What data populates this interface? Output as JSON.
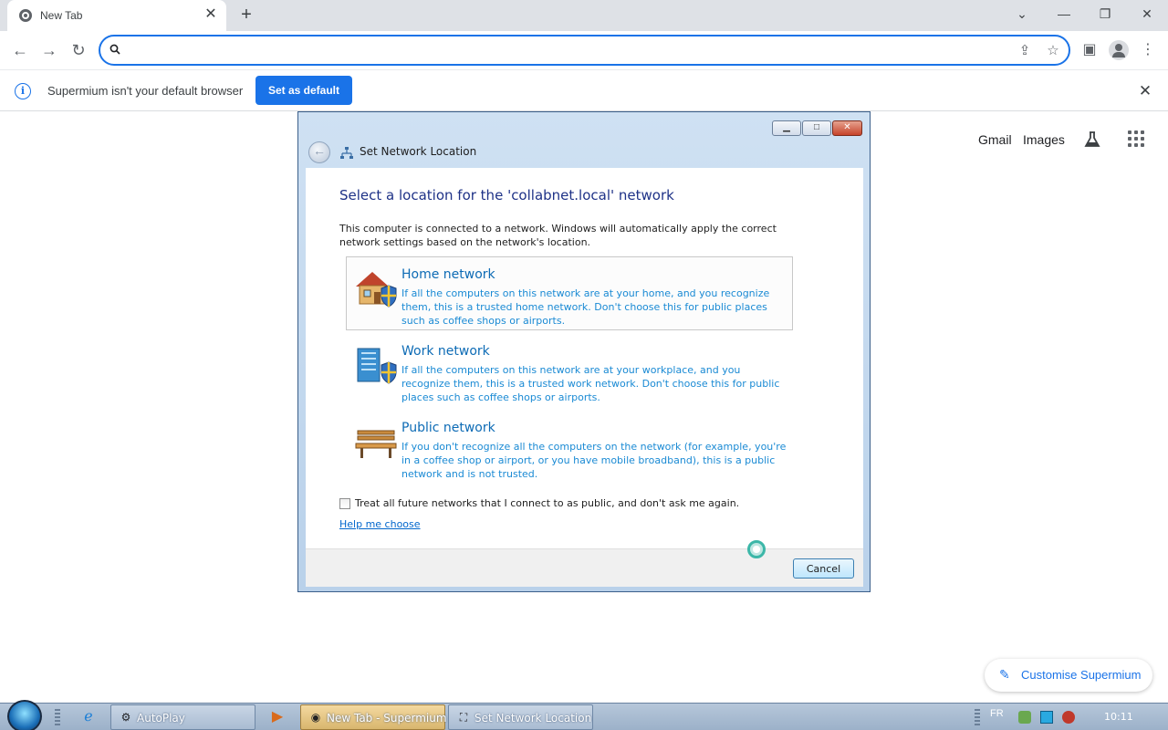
{
  "browser": {
    "tab": {
      "title": "New Tab",
      "close": "✕"
    },
    "new_tab": "+",
    "window_controls": {
      "minimize": "⌄",
      "min": "—",
      "restore": "❐",
      "close": "✕"
    },
    "omnibox": {
      "value": "",
      "placeholder": ""
    },
    "infobar": {
      "message": "Supermium isn't your default browser",
      "button": "Set as default",
      "close": "✕"
    },
    "ntp": {
      "links": [
        "Gmail",
        "Images"
      ],
      "customise_label": "Customise Supermium"
    }
  },
  "dialog": {
    "title": "Set Network Location",
    "heading": "Select a location for the 'collabnet.local' network",
    "description": "This computer is connected to a network. Windows will automatically apply the correct network settings based on the network's location.",
    "options": [
      {
        "title": "Home network",
        "description": "If all the computers on this network are at your home, and you recognize them, this is a trusted home network.  Don't choose this for public places such as coffee shops or airports.",
        "icon": "house-icon"
      },
      {
        "title": "Work network",
        "description": "If all the computers on this network are at your workplace, and you recognize them, this is a trusted work network.  Don't choose this for public places such as coffee shops or airports.",
        "icon": "office-building-icon"
      },
      {
        "title": "Public network",
        "description": "If you don't recognize all the computers on the network (for example, you're in a coffee shop or airport, or you have mobile broadband), this is a public network and is not trusted.",
        "icon": "park-bench-icon"
      }
    ],
    "checkbox_label": "Treat all future networks that I connect to as public, and don't ask me again.",
    "help_link": "Help me choose",
    "cancel": "Cancel"
  },
  "taskbar": {
    "buttons": [
      {
        "label": "AutoPlay",
        "active": false
      },
      {
        "label": "New Tab - Supermium",
        "active": true
      },
      {
        "label": "Set Network Location",
        "active": false
      }
    ],
    "language": "FR",
    "clock": "10:11"
  },
  "colors": {
    "accent": "#1a73e8",
    "dialog_link": "#0d6bb5",
    "taskbar_active": "#d8b66e"
  }
}
